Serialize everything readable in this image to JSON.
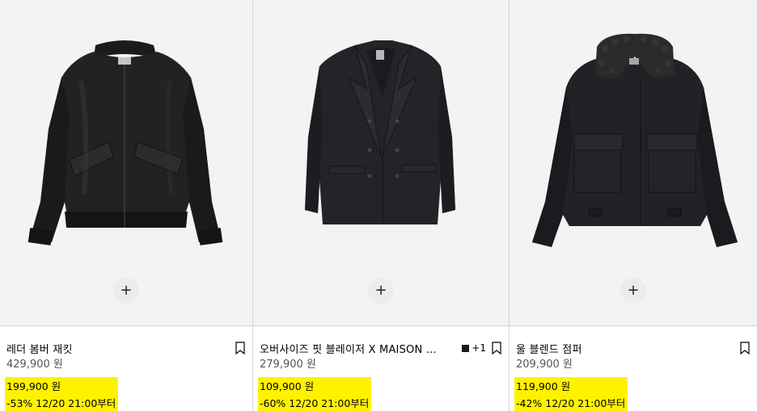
{
  "products": [
    {
      "name": "레더 봄버 재킷",
      "original_price": "429,900 원",
      "sale_price": "199,900 원",
      "discount_note": "-53% 12/20 21:00부터",
      "swatch_count": "",
      "image_icon": "leather-bomber-jacket"
    },
    {
      "name": "오버사이즈 핏 블레이저 X MAISON ...",
      "original_price": "279,900 원",
      "sale_price": "109,900 원",
      "discount_note": "-60% 12/20 21:00부터",
      "swatch_count": "+1",
      "image_icon": "double-breasted-blazer"
    },
    {
      "name": "울 블렌드 점퍼",
      "original_price": "209,900 원",
      "sale_price": "119,900 원",
      "discount_note": "-42% 12/20 21:00부터",
      "swatch_count": "",
      "image_icon": "wool-blend-jumper"
    }
  ],
  "add_button_symbol": "+",
  "colors": {
    "sale_highlight": "#fff200",
    "image_bg": "#f3f3f3",
    "swatch": "#1a1a1a"
  }
}
